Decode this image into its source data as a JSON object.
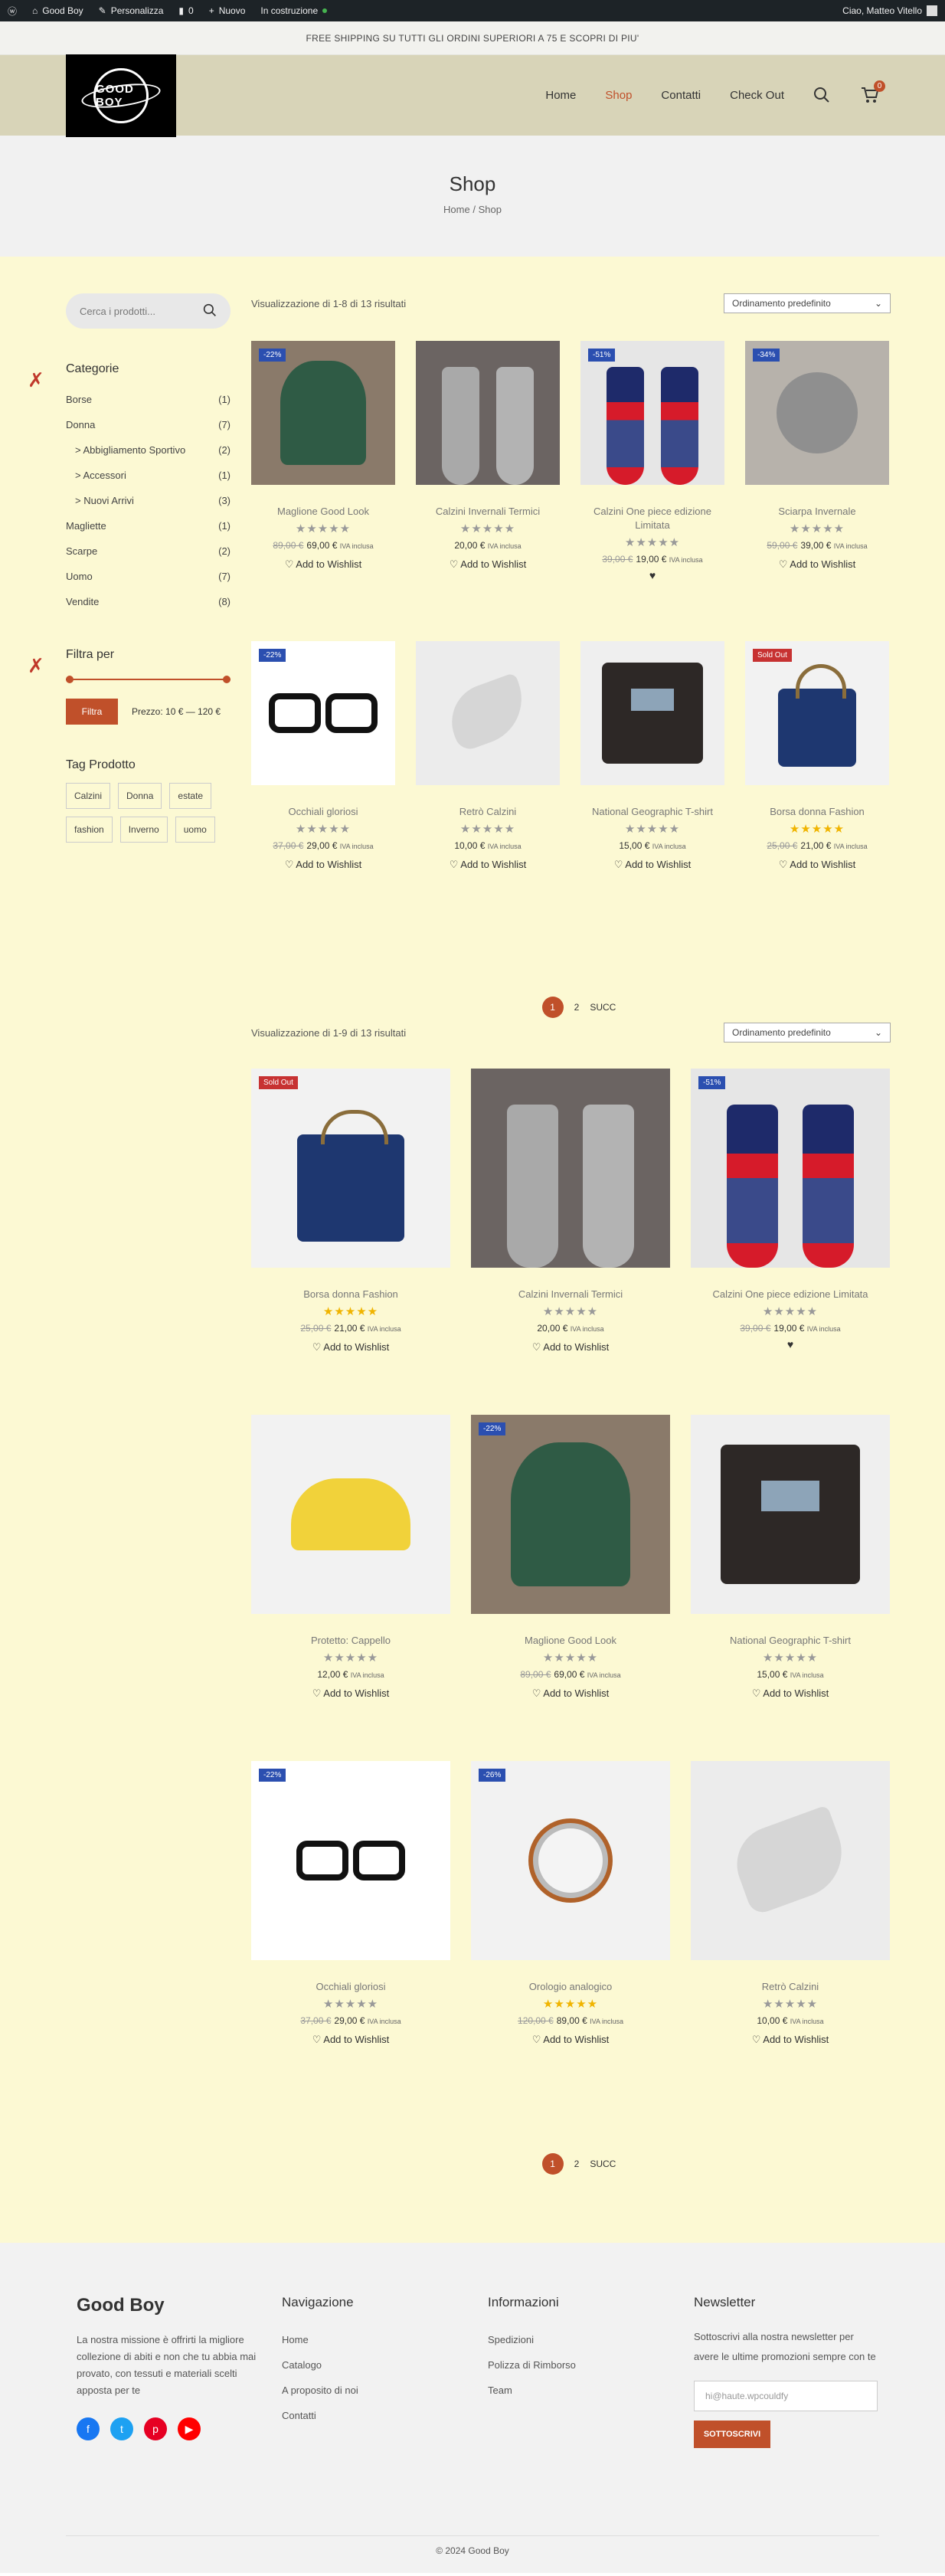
{
  "adminbar": {
    "site": "Good Boy",
    "customize": "Personalizza",
    "comments": "0",
    "new": "Nuovo",
    "status": "In costruzione",
    "greeting": "Ciao, Matteo Vitello"
  },
  "topbar": {
    "text": "FREE SHIPPING SU TUTTI GLI ORDINI SUPERIORI A 75 E SCOPRI DI PIU'"
  },
  "header": {
    "logo_text": "GOOD BOY",
    "nav": [
      "Home",
      "Shop",
      "Contatti",
      "Check Out"
    ],
    "cart_count": "0"
  },
  "pagehead": {
    "title": "Shop",
    "crumb_home": "Home",
    "crumb_sep": "/",
    "crumb_current": "Shop"
  },
  "sidebar": {
    "search_placeholder": "Cerca i prodotti...",
    "categories_title": "Categorie",
    "categories": [
      {
        "label": "Borse",
        "count": "(1)",
        "sub": false
      },
      {
        "label": "Donna",
        "count": "(7)",
        "sub": false
      },
      {
        "label": "> Abbigliamento Sportivo",
        "count": "(2)",
        "sub": true
      },
      {
        "label": "> Accessori",
        "count": "(1)",
        "sub": true
      },
      {
        "label": "> Nuovi Arrivi",
        "count": "(3)",
        "sub": true
      },
      {
        "label": "Magliette",
        "count": "(1)",
        "sub": false
      },
      {
        "label": "Scarpe",
        "count": "(2)",
        "sub": false
      },
      {
        "label": "Uomo",
        "count": "(7)",
        "sub": false
      },
      {
        "label": "Vendite",
        "count": "(8)",
        "sub": false
      }
    ],
    "filter_title": "Filtra per",
    "filter_button": "Filtra",
    "price_label": "Prezzo: 10 € — 120 €",
    "tags_title": "Tag Prodotto",
    "tags": [
      "Calzini",
      "Donna",
      "estate",
      "fashion",
      "Inverno",
      "uomo"
    ]
  },
  "grid1": {
    "results": "Visualizzazione di 1-8 di 13 risultati",
    "sort": "Ordinamento predefinito",
    "products": [
      {
        "name": "Maglione Good Look",
        "badge": "-22%",
        "badge_type": "sale",
        "old": "89,00 €",
        "price": "69,00 €",
        "tax": "IVA inclusa",
        "rating": 0,
        "wishlist": "Add to Wishlist",
        "art": "sweater"
      },
      {
        "name": "Calzini Invernali Termici",
        "badge": "",
        "badge_type": "",
        "old": "",
        "price": "20,00 €",
        "tax": "IVA inclusa",
        "rating": 0,
        "wishlist": "Add to Wishlist",
        "art": "graysock"
      },
      {
        "name": "Calzini One piece edizione Limitata",
        "badge": "-51%",
        "badge_type": "sale",
        "old": "39,00 €",
        "price": "19,00 €",
        "tax": "IVA inclusa",
        "rating": 0,
        "wishlist": "♥",
        "art": "redsock"
      },
      {
        "name": "Sciarpa Invernale",
        "badge": "-34%",
        "badge_type": "sale",
        "old": "59,00 €",
        "price": "39,00 €",
        "tax": "IVA inclusa",
        "rating": 0,
        "wishlist": "Add to Wishlist",
        "art": "scarf"
      },
      {
        "name": "Occhiali gloriosi",
        "badge": "-22%",
        "badge_type": "sale",
        "old": "37,00 €",
        "price": "29,00 €",
        "tax": "IVA inclusa",
        "rating": 0,
        "wishlist": "Add to Wishlist",
        "art": "glasses"
      },
      {
        "name": "Retrò Calzini",
        "badge": "",
        "badge_type": "",
        "old": "",
        "price": "10,00 €",
        "tax": "IVA inclusa",
        "rating": 0,
        "wishlist": "Add to Wishlist",
        "art": "lsock"
      },
      {
        "name": "National Geographic T-shirt",
        "badge": "",
        "badge_type": "",
        "old": "",
        "price": "15,00 €",
        "tax": "IVA inclusa",
        "rating": 0,
        "wishlist": "Add to Wishlist",
        "art": "tee"
      },
      {
        "name": "Borsa donna Fashion",
        "badge": "Sold Out",
        "badge_type": "sold",
        "old": "25,00 €",
        "price": "21,00 €",
        "tax": "IVA inclusa",
        "rating": 5,
        "wishlist": "Add to Wishlist",
        "art": "bag"
      }
    ]
  },
  "pager1": {
    "current": "1",
    "next_page": "2",
    "next": "SUCC"
  },
  "grid2": {
    "results": "Visualizzazione di 1-9 di 13 risultati",
    "sort": "Ordinamento predefinito",
    "products": [
      {
        "name": "Borsa donna Fashion",
        "badge": "Sold Out",
        "badge_type": "sold",
        "old": "25,00 €",
        "price": "21,00 €",
        "tax": "IVA inclusa",
        "rating": 5,
        "wishlist": "Add to Wishlist",
        "art": "bag"
      },
      {
        "name": "Calzini Invernali Termici",
        "badge": "",
        "badge_type": "",
        "old": "",
        "price": "20,00 €",
        "tax": "IVA inclusa",
        "rating": 0,
        "wishlist": "Add to Wishlist",
        "art": "graysock"
      },
      {
        "name": "Calzini One piece edizione Limitata",
        "badge": "-51%",
        "badge_type": "sale",
        "old": "39,00 €",
        "price": "19,00 €",
        "tax": "IVA inclusa",
        "rating": 0,
        "wishlist": "♥",
        "art": "redsock"
      },
      {
        "name": "Protetto: Cappello",
        "badge": "",
        "badge_type": "",
        "old": "",
        "price": "12,00 €",
        "tax": "IVA inclusa",
        "rating": 0,
        "wishlist": "Add to Wishlist",
        "art": "cap"
      },
      {
        "name": "Maglione Good Look",
        "badge": "-22%",
        "badge_type": "sale",
        "old": "89,00 €",
        "price": "69,00 €",
        "tax": "IVA inclusa",
        "rating": 0,
        "wishlist": "Add to Wishlist",
        "art": "sweater"
      },
      {
        "name": "National Geographic T-shirt",
        "badge": "",
        "badge_type": "",
        "old": "",
        "price": "15,00 €",
        "tax": "IVA inclusa",
        "rating": 0,
        "wishlist": "Add to Wishlist",
        "art": "tee"
      },
      {
        "name": "Occhiali gloriosi",
        "badge": "-22%",
        "badge_type": "sale",
        "old": "37,00 €",
        "price": "29,00 €",
        "tax": "IVA inclusa",
        "rating": 0,
        "wishlist": "Add to Wishlist",
        "art": "glasses"
      },
      {
        "name": "Orologio analogico",
        "badge": "-26%",
        "badge_type": "sale",
        "old": "120,00 €",
        "price": "89,00 €",
        "tax": "IVA inclusa",
        "rating": 5,
        "wishlist": "Add to Wishlist",
        "art": "watch"
      },
      {
        "name": "Retrò Calzini",
        "badge": "",
        "badge_type": "",
        "old": "",
        "price": "10,00 €",
        "tax": "IVA inclusa",
        "rating": 0,
        "wishlist": "Add to Wishlist",
        "art": "lsock"
      }
    ]
  },
  "pager2": {
    "current": "1",
    "next_page": "2",
    "next": "SUCC"
  },
  "footer": {
    "brand": "Good Boy",
    "mission": "La nostra missione è offrirti la migliore collezione di abiti e non che tu abbia mai provato, con tessuti e materiali scelti apposta per te",
    "nav_title": "Navigazione",
    "nav": [
      "Home",
      "Catalogo",
      "A proposito di noi",
      "Contatti"
    ],
    "info_title": "Informazioni",
    "info": [
      "Spedizioni",
      "Polizza di Rimborso",
      "Team"
    ],
    "news_title": "Newsletter",
    "news_text": "Sottoscrivi alla nostra newsletter per avere le ultime promozioni sempre con te",
    "email_placeholder": "hi@haute.wpcouldfy",
    "subscribe": "SOTTOSCRIVI",
    "copyright": "© 2024 Good Boy"
  },
  "colors": {
    "accent": "#c0502a",
    "main_bg": "#fcf9d3",
    "header_bg": "#d8d4b8",
    "sale_badge": "#2b4fb0",
    "sold_badge": "#c73232"
  }
}
